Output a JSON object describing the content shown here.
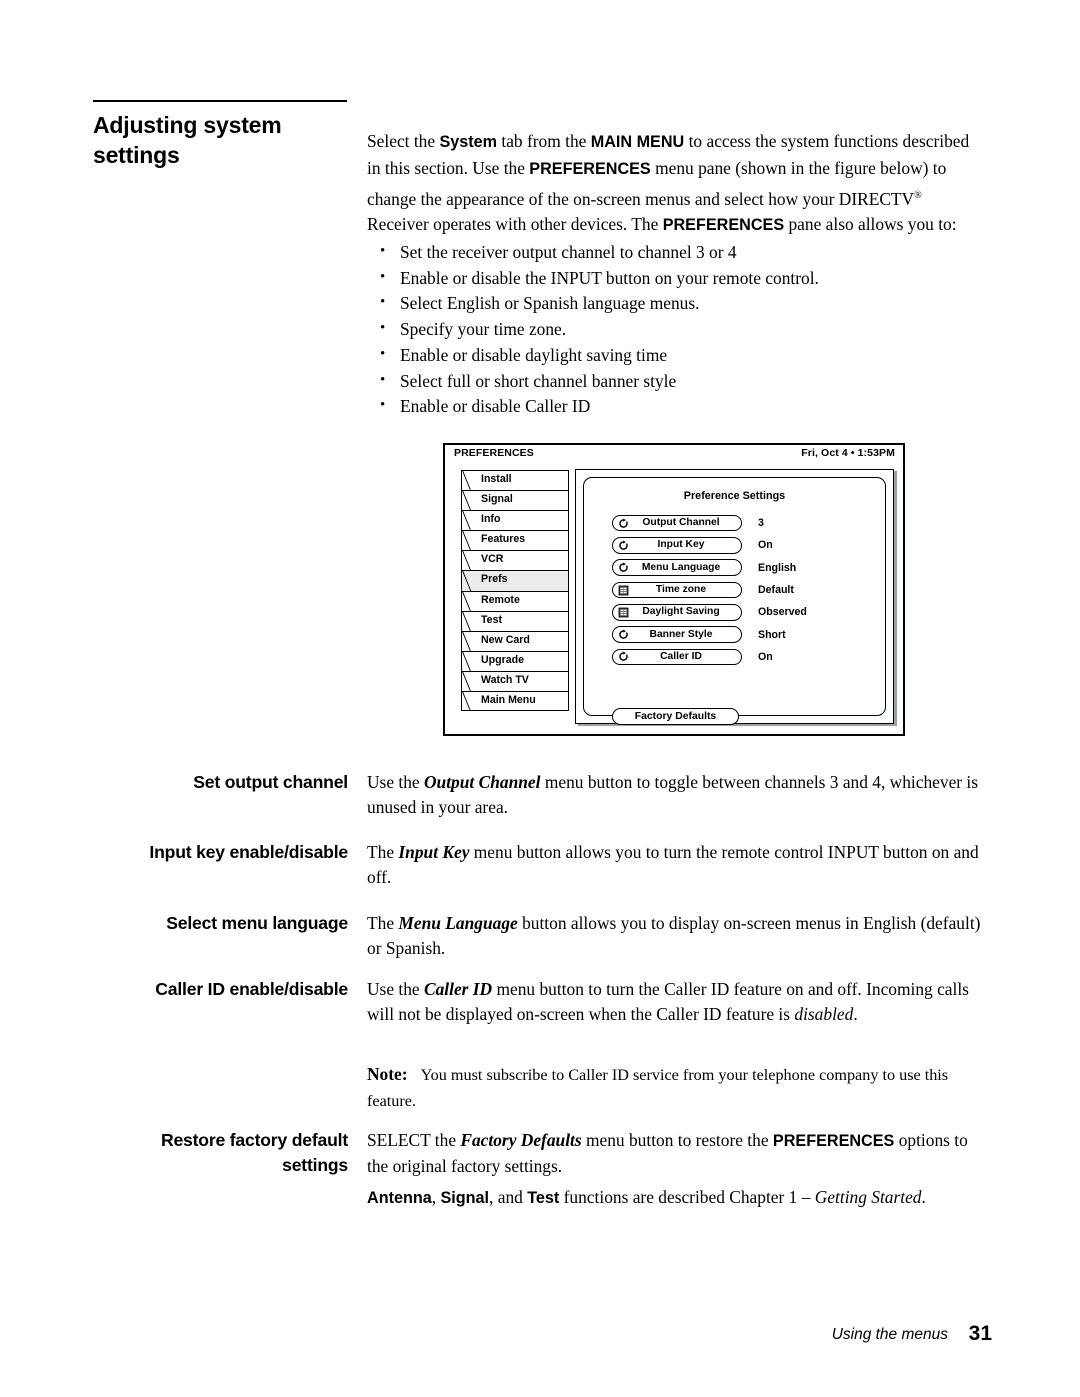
{
  "heading": {
    "line1": "Adjusting system",
    "line2": "settings"
  },
  "intro": {
    "p1_a": "Select the ",
    "p1_b_system": "System",
    "p1_c": " tab from the ",
    "p1_d_mainmenu": "MAIN MENU",
    "p1_e": " to access the system functions described in this section. Use the ",
    "p1_f_prefs": "PREFERENCES",
    "p1_g": " menu pane (shown in the figure below) to change the appearance of the on-screen menus and select how your DIRECTV",
    "p1_reg": "®",
    "p1_h": " Receiver operates with other devices. The ",
    "p1_i_prefs": "PREFERENCES",
    "p1_j": " pane also allows you to:"
  },
  "bullets": [
    "Set the receiver output channel to channel 3 or 4",
    "Enable or disable the INPUT button on your remote control.",
    "Select English or Spanish language menus.",
    "Specify your time zone.",
    "Enable or disable daylight saving time",
    "Select full or short channel banner style",
    "Enable or disable Caller ID"
  ],
  "figure": {
    "header_title": "PREFERENCES",
    "clock": "Fri, Oct 4  •  1:53PM",
    "tabs": [
      {
        "label": "Install",
        "selected": false
      },
      {
        "label": "Signal",
        "selected": false
      },
      {
        "label": "Info",
        "selected": false
      },
      {
        "label": "Features",
        "selected": false
      },
      {
        "label": "VCR",
        "selected": false
      },
      {
        "label": "Prefs",
        "selected": true
      },
      {
        "label": "Remote",
        "selected": false
      },
      {
        "label": "Test",
        "selected": false
      },
      {
        "label": "New Card",
        "selected": false
      },
      {
        "label": "Upgrade",
        "selected": false
      },
      {
        "label": "Watch TV",
        "selected": false
      },
      {
        "label": "Main Menu",
        "selected": false
      }
    ],
    "pane_title": "Preference Settings",
    "options": [
      {
        "label": "Output Channel",
        "value": "3",
        "icon": "cycle-arrow-icon"
      },
      {
        "label": "Input Key",
        "value": "On",
        "icon": "cycle-arrow-icon"
      },
      {
        "label": "Menu Language",
        "value": "English",
        "icon": "cycle-arrow-icon"
      },
      {
        "label": "Time zone",
        "value": "Default",
        "icon": "list-menu-icon"
      },
      {
        "label": "Daylight Saving",
        "value": "Observed",
        "icon": "list-menu-icon"
      },
      {
        "label": "Banner Style",
        "value": "Short",
        "icon": "cycle-arrow-icon"
      },
      {
        "label": "Caller ID",
        "value": "On",
        "icon": "cycle-arrow-icon"
      }
    ],
    "factory_defaults_label": "Factory Defaults",
    "selected_tab_bg": "#ececec",
    "shadow_color": "#9aa3a3"
  },
  "sections": [
    {
      "term": "Set output channel",
      "body_a": "Use the ",
      "body_em": "Output Channel",
      "body_b": " menu button to toggle between channels 3 and 4, whichever is unused in your area."
    },
    {
      "term": "Input key enable/disable",
      "body_a": "The ",
      "body_em": "Input Key",
      "body_b": " menu button allows you to turn the remote control INPUT button on and off."
    },
    {
      "term": "Select menu language",
      "body_a": "The ",
      "body_em": "Menu Language",
      "body_b": " button allows you to display on-screen menus in English (default) or Spanish."
    },
    {
      "term": "Caller ID enable/disable",
      "body_a": "Use the ",
      "body_em": "Caller ID",
      "body_b": " menu button to turn the Caller ID feature on and off. Incoming calls will not be displayed on-screen when the Caller ID feature is ",
      "body_em2": "disabled",
      "body_c": "."
    }
  ],
  "note": {
    "label": "Note:",
    "text": "You must subscribe to Caller ID service from your telephone company to use this feature."
  },
  "restore": {
    "term_line1": "Restore factory default",
    "term_line2": "settings",
    "body_a": "SELECT the ",
    "body_em": "Factory Defaults",
    "body_b": " menu button to restore the ",
    "body_strong": "PREFERENCES",
    "body_c": " options to the original factory settings."
  },
  "closing": {
    "a_antenna": "Antenna",
    "sep1": ", ",
    "b_signal": "Signal",
    "sep2": ", and ",
    "c_test": "Test",
    "tail": " functions are described Chapter 1 – ",
    "em": "Getting Started",
    "end": "."
  },
  "footer": {
    "label": "Using the menus",
    "page": "31"
  }
}
